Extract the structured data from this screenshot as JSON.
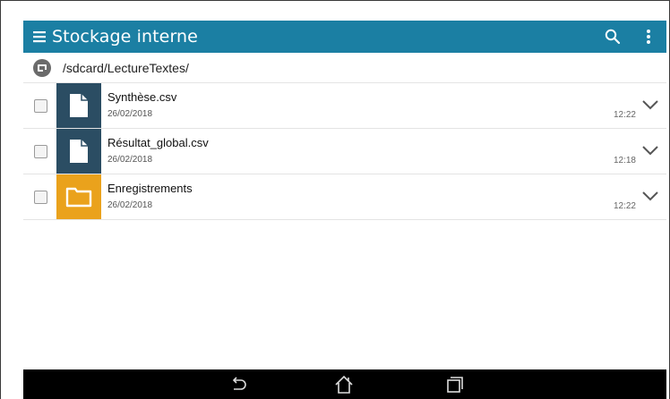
{
  "app": {
    "title": "Stockage interne"
  },
  "toolbar": {
    "search_icon": "search-icon",
    "overflow_icon": "more-vert-icon"
  },
  "path": {
    "text": "/sdcard/LectureTextes/",
    "icon": "sd-storage-icon"
  },
  "files": [
    {
      "name": "Synthèse.csv",
      "date": "26/02/2018",
      "time": "12:22",
      "type": "file"
    },
    {
      "name": "Résultat_global.csv",
      "date": "26/02/2018",
      "time": "12:18",
      "type": "file"
    },
    {
      "name": "Enregistrements",
      "date": "26/02/2018",
      "time": "12:22",
      "type": "folder"
    }
  ],
  "colors": {
    "appbar": "#1b7fa3",
    "file_thumb": "#2b4d63",
    "folder_thumb": "#eaa21c",
    "navbar": "#000000"
  },
  "navbar": {
    "back": "back-icon",
    "home": "home-icon",
    "recents": "recents-icon"
  }
}
